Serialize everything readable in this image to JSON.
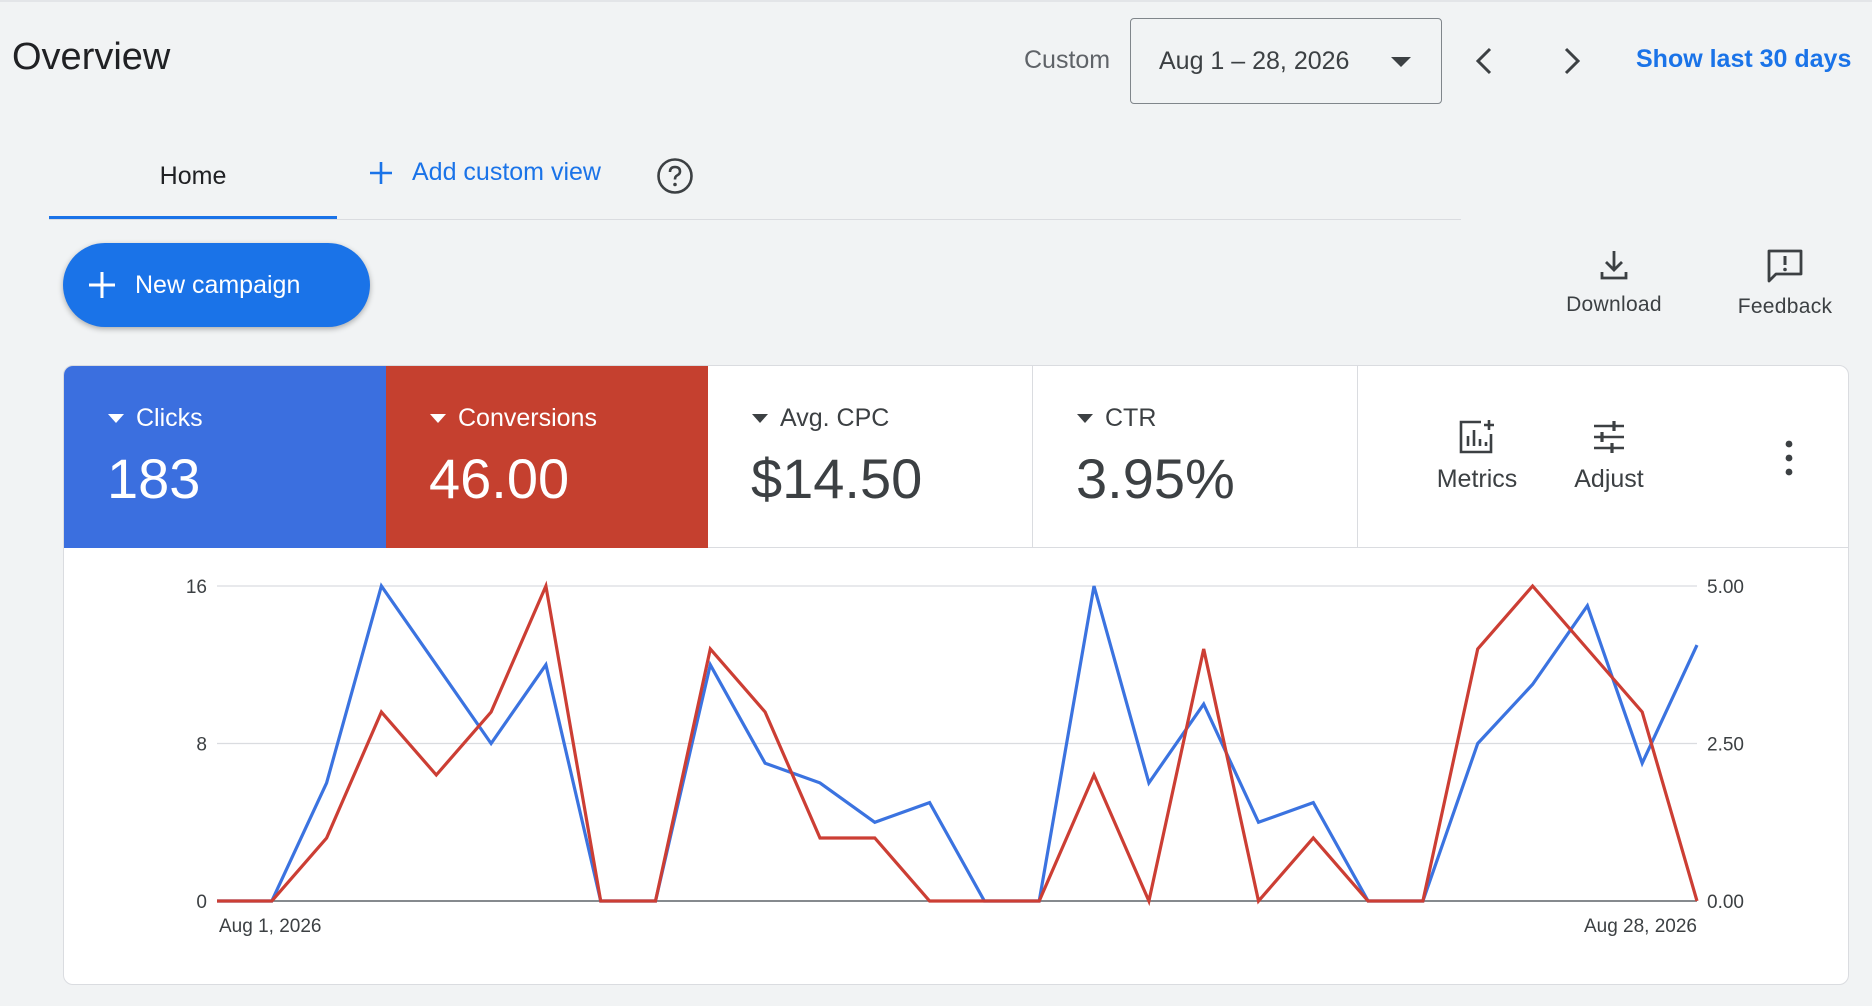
{
  "header": {
    "title": "Overview",
    "custom_label": "Custom",
    "date_range": "Aug 1 – 28, 2026",
    "show_last_label": "Show last 30 days"
  },
  "tabs": {
    "home_label": "Home",
    "add_view_label": "Add custom view"
  },
  "actions": {
    "new_campaign_label": "New campaign",
    "download_label": "Download",
    "feedback_label": "Feedback"
  },
  "scorecards": [
    {
      "label": "Clicks",
      "value": "183",
      "color": "#3b6fdf"
    },
    {
      "label": "Conversions",
      "value": "46.00",
      "color": "#c5402f"
    },
    {
      "label": "Avg. CPC",
      "value": "$14.50"
    },
    {
      "label": "CTR",
      "value": "3.95%"
    }
  ],
  "chart_tools": {
    "metrics_label": "Metrics",
    "adjust_label": "Adjust"
  },
  "chart_data": {
    "type": "line",
    "x_start_label": "Aug 1, 2026",
    "x_end_label": "Aug 28, 2026",
    "left_axis": {
      "ticks": [
        "0",
        "8",
        "16"
      ],
      "ylim": [
        0,
        16
      ]
    },
    "right_axis": {
      "ticks": [
        "0.00",
        "2.50",
        "5.00"
      ],
      "ylim": [
        0,
        5
      ]
    },
    "grid": true,
    "series": [
      {
        "name": "Clicks",
        "color": "#3b73e0",
        "axis": "left",
        "values": [
          0,
          0,
          6,
          16,
          12,
          8,
          12,
          0,
          0,
          12,
          7,
          6,
          4,
          5,
          0,
          0,
          16,
          6,
          10,
          4,
          5,
          0,
          0,
          8,
          11,
          15,
          7,
          13
        ]
      },
      {
        "name": "Conversions",
        "color": "#cc3e34",
        "axis": "right",
        "values": [
          0,
          0,
          1,
          3,
          2,
          3,
          5,
          0,
          0,
          4,
          3,
          1,
          1,
          0,
          0,
          0,
          2,
          0,
          4,
          0,
          1,
          0,
          0,
          4,
          5,
          4,
          3,
          0
        ]
      }
    ]
  }
}
